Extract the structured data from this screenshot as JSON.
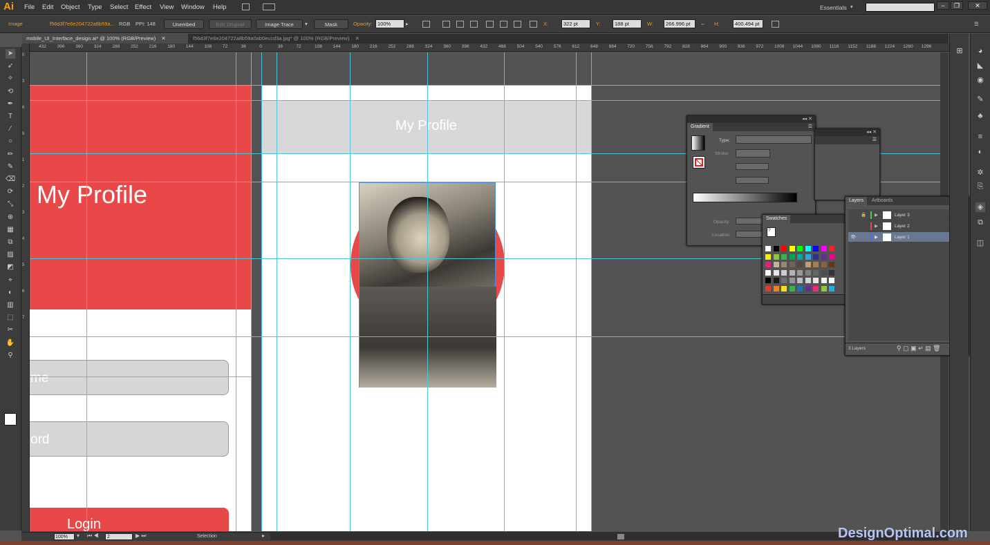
{
  "app": {
    "logo": "Ai"
  },
  "menu": [
    "File",
    "Edit",
    "Object",
    "Type",
    "Select",
    "Effect",
    "View",
    "Window",
    "Help"
  ],
  "workspace": "Essentials",
  "window_controls": {
    "min": "–",
    "max": "❐",
    "close": "✕"
  },
  "control_bar": {
    "type_label": "Image",
    "filename": "f56d3f7e6e204722a8b59a...",
    "color_mode": "RGB",
    "ppi": "PPI: 148",
    "unembed": "Unembed",
    "edit_original": "Edit Original",
    "image_trace": "Image Trace",
    "mask": "Mask",
    "opacity_label": "Opacity:",
    "opacity_value": "100%",
    "x_label": "X:",
    "x_value": "322 pt",
    "y_label": "Y:",
    "y_value": "188 pt",
    "w_label": "W:",
    "w_value": "266.996 pt",
    "h_label": "H:",
    "h_value": "400.494 pt"
  },
  "tabs": [
    {
      "label": "mobile_UI_Interface_design.ai* @ 100% (RGB/Preview)",
      "close": "✕"
    },
    {
      "label": "f56d3f7e6e204722a8b59a0ab0eccd3a.jpg* @ 100% (RGB/Preview)",
      "close": "✕"
    }
  ],
  "ruler_h": [
    "432",
    "396",
    "360",
    "324",
    "288",
    "252",
    "216",
    "180",
    "144",
    "108",
    "72",
    "36",
    "0",
    "36",
    "72",
    "108",
    "144",
    "180",
    "216",
    "252",
    "288",
    "324",
    "360",
    "396",
    "432",
    "468",
    "504",
    "540",
    "576",
    "612",
    "648",
    "684",
    "720",
    "756",
    "792",
    "828",
    "864",
    "900",
    "936",
    "972",
    "1008",
    "1044",
    "1080",
    "1116",
    "1152",
    "1188",
    "1224",
    "1260",
    "1296"
  ],
  "ruler_v": [
    "0",
    "3",
    "6",
    "9",
    "1",
    "2",
    "3",
    "4",
    "5",
    "6",
    "7"
  ],
  "artboard_left": {
    "header_title": "My Profile",
    "username_fragment": "me",
    "password_fragment": "ord",
    "login_fragment": "Login"
  },
  "artboard_right": {
    "header_title": "My Profile"
  },
  "gradient_panel": {
    "tab": "Gradient",
    "type_label": "Type:",
    "stroke_label": "Stroke:",
    "opacity_label": "Opacity:",
    "location_label": "Location:"
  },
  "swatches_panel": {
    "tab": "Swatches",
    "help": "?"
  },
  "layers_panel": {
    "tab_layers": "Layers",
    "tab_artboards": "Artboards",
    "layers": [
      {
        "name": "Layer 3",
        "color": "#4ccd4c",
        "visible": false,
        "locked": true
      },
      {
        "name": "Layer 2",
        "color": "#e94b4b",
        "visible": false,
        "locked": false
      },
      {
        "name": "Layer 1",
        "color": "#4b6bea",
        "visible": true,
        "locked": false,
        "selected": true
      }
    ],
    "count": "3 Layers"
  },
  "status": {
    "zoom": "100%",
    "page": "2",
    "tool": "Selection"
  },
  "watermark": "DesignOptimal.com",
  "colors": {
    "red": "#e84848",
    "guide": "#4cc7d8",
    "header_gray": "#d8d8d8",
    "field_gray": "#d6d6d6"
  }
}
